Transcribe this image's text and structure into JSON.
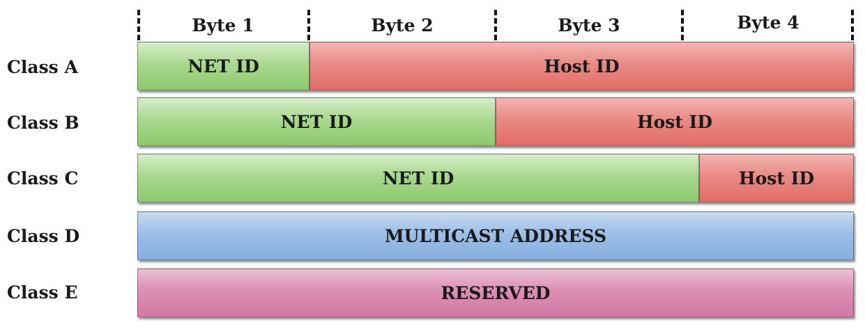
{
  "bytes": [
    "Byte 1",
    "Byte 2",
    "Byte 3",
    "Byte 4"
  ],
  "rows": [
    {
      "label": "Class A",
      "segments": [
        {
          "text": "NET ID",
          "kind": "net",
          "bytes": 1
        },
        {
          "text": "Host ID",
          "kind": "host",
          "bytes": 3
        }
      ]
    },
    {
      "label": "Class B",
      "segments": [
        {
          "text": "NET ID",
          "kind": "net",
          "bytes": 2
        },
        {
          "text": "Host ID",
          "kind": "host",
          "bytes": 2
        }
      ]
    },
    {
      "label": "Class C",
      "segments": [
        {
          "text": "NET ID",
          "kind": "net",
          "bytes": 3
        },
        {
          "text": "Host ID",
          "kind": "host",
          "bytes": 1
        }
      ]
    },
    {
      "label": "Class D",
      "segments": [
        {
          "text": "MULTICAST ADDRESS",
          "kind": "multicast",
          "bytes": 4
        }
      ]
    },
    {
      "label": "Class E",
      "segments": [
        {
          "text": "RESERVED",
          "kind": "reserved",
          "bytes": 4
        }
      ]
    }
  ],
  "colors": {
    "net": "#a9d98f",
    "host": "#e98a84",
    "multicast": "#9dbfe7",
    "reserved": "#dc8fb4"
  }
}
